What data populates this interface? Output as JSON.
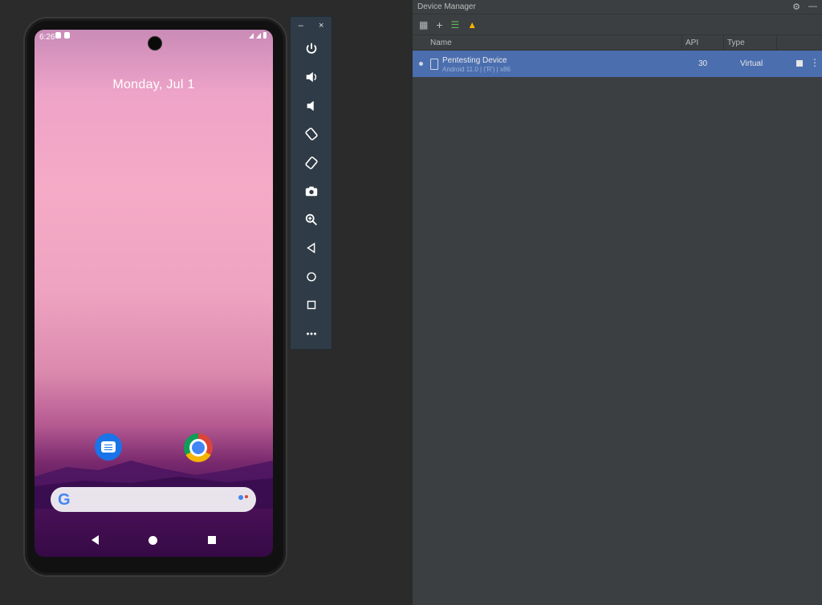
{
  "emulator": {
    "status_time": "6:26",
    "date": "Monday, Jul 1",
    "dock_apps": [
      "Messages",
      "Chrome"
    ],
    "toolbar": {
      "minimize_label": "–",
      "close_label": "×",
      "buttons": [
        "power",
        "volume-up",
        "volume-down",
        "rotate-left",
        "rotate-right",
        "screenshot",
        "zoom",
        "back",
        "home",
        "overview",
        "more"
      ]
    }
  },
  "device_manager": {
    "title": "Device Manager",
    "columns": {
      "name": "Name",
      "api": "API",
      "type": "Type"
    },
    "devices": [
      {
        "name": "Pentesting Device",
        "subtitle": "Android 11.0 | ('R') | x86",
        "api": "30",
        "type": "Virtual"
      }
    ]
  }
}
